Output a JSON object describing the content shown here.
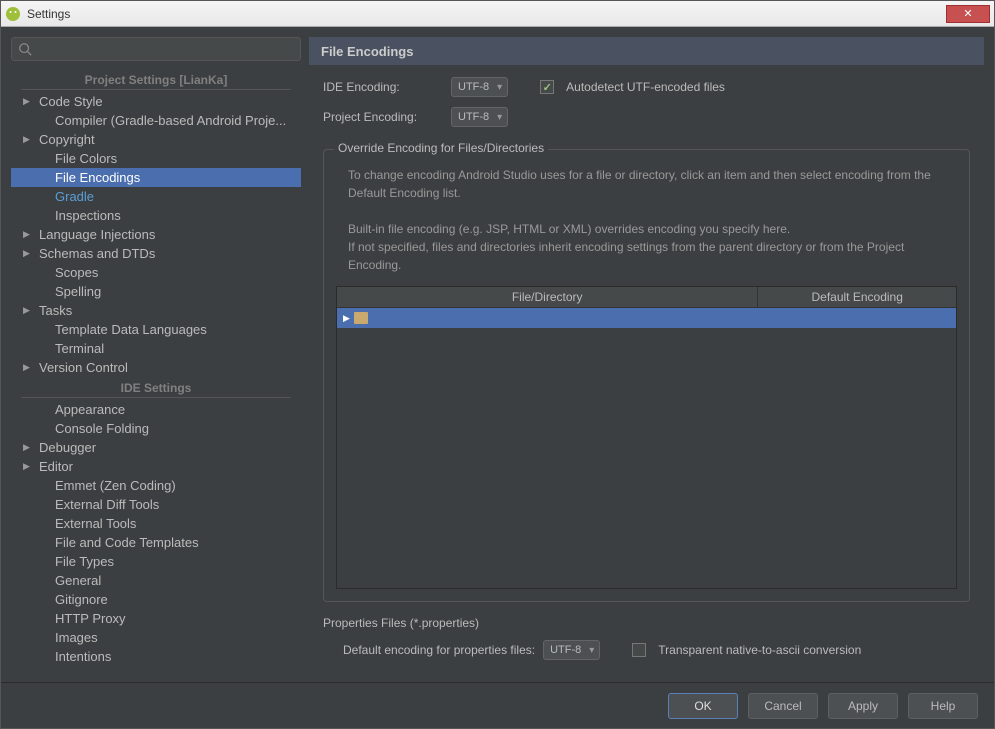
{
  "window": {
    "title": "Settings"
  },
  "sidebar": {
    "search_placeholder": "",
    "section1": "Project Settings [LianKa]",
    "section2": "IDE Settings",
    "items1": [
      {
        "label": "Code Style",
        "exp": true
      },
      {
        "label": "Compiler (Gradle-based Android Proje...",
        "child": true
      },
      {
        "label": "Copyright",
        "exp": true
      },
      {
        "label": "File Colors",
        "child": true
      },
      {
        "label": "File Encodings",
        "child": true,
        "selected": true
      },
      {
        "label": "Gradle",
        "child": true,
        "link": true
      },
      {
        "label": "Inspections",
        "child": true
      },
      {
        "label": "Language Injections",
        "exp": true
      },
      {
        "label": "Schemas and DTDs",
        "exp": true
      },
      {
        "label": "Scopes",
        "child": true
      },
      {
        "label": "Spelling",
        "child": true
      },
      {
        "label": "Tasks",
        "exp": true
      },
      {
        "label": "Template Data Languages",
        "child": true
      },
      {
        "label": "Terminal",
        "child": true
      },
      {
        "label": "Version Control",
        "exp": true
      }
    ],
    "items2": [
      {
        "label": "Appearance",
        "child": true
      },
      {
        "label": "Console Folding",
        "child": true
      },
      {
        "label": "Debugger",
        "exp": true
      },
      {
        "label": "Editor",
        "exp": true
      },
      {
        "label": "Emmet (Zen Coding)",
        "child": true
      },
      {
        "label": "External Diff Tools",
        "child": true
      },
      {
        "label": "External Tools",
        "child": true
      },
      {
        "label": "File and Code Templates",
        "child": true
      },
      {
        "label": "File Types",
        "child": true
      },
      {
        "label": "General",
        "child": true
      },
      {
        "label": "Gitignore",
        "child": true
      },
      {
        "label": "HTTP Proxy",
        "child": true
      },
      {
        "label": "Images",
        "child": true
      },
      {
        "label": "Intentions",
        "child": true
      }
    ]
  },
  "main": {
    "title": "File Encodings",
    "ide_encoding_label": "IDE Encoding:",
    "ide_encoding_value": "UTF-8",
    "project_encoding_label": "Project Encoding:",
    "project_encoding_value": "UTF-8",
    "autodetect_label": "Autodetect UTF-encoded files",
    "override_title": "Override Encoding for Files/Directories",
    "help1": "To change encoding Android Studio uses for a file or directory, click an item and then select encoding from the Default Encoding list.",
    "help2": "Built-in file encoding (e.g. JSP, HTML or XML) overrides encoding you specify here.",
    "help3": "If not specified, files and directories inherit encoding settings from the parent directory or from the Project Encoding.",
    "col1": "File/Directory",
    "col2": "Default Encoding",
    "props_title": "Properties Files (*.properties)",
    "props_label": "Default encoding for properties files:",
    "props_value": "UTF-8",
    "transparent_label": "Transparent native-to-ascii conversion"
  },
  "footer": {
    "ok": "OK",
    "cancel": "Cancel",
    "apply": "Apply",
    "help": "Help"
  }
}
